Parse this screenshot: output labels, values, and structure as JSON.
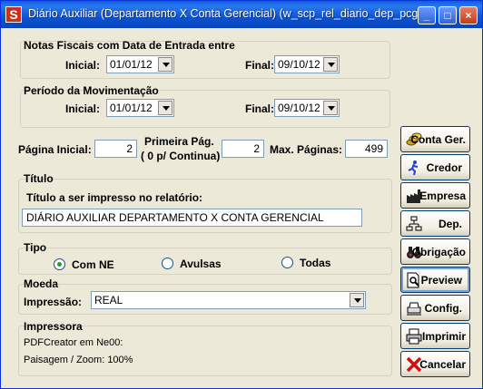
{
  "window": {
    "title": "Diário Auxiliar (Departamento X Conta Gerencial) (w_scp_rel_diario_dep_pcg)",
    "icon_letter": "S",
    "controls": [
      "_",
      "□",
      "×"
    ]
  },
  "notas": {
    "title": "Notas Fiscais com Data de Entrada entre",
    "inicial_label": "Inicial:",
    "inicial_value": "01/01/12",
    "final_label": "Final:",
    "final_value": "09/10/12"
  },
  "periodo": {
    "title": "Período da Movimentação",
    "inicial_label": "Inicial:",
    "inicial_value": "01/01/12",
    "final_label": "Final:",
    "final_value": "09/10/12"
  },
  "paginas": {
    "inicial_label": "Página Inicial:",
    "inicial_value": "2",
    "primeira_label_1": "Primeira Pág.",
    "primeira_label_2": "( 0 p/ Continua)",
    "primeira_value": "2",
    "max_label": "Max. Páginas:",
    "max_value": "499"
  },
  "titulo": {
    "group_label": "Título",
    "field_label": "Título a ser impresso no relatório:",
    "value": "DIÁRIO AUXILIAR DEPARTAMENTO X CONTA GERENCIAL"
  },
  "tipo": {
    "group_label": "Tipo",
    "options": [
      "Com NE",
      "Avulsas",
      "Todas"
    ],
    "selected": "Com NE"
  },
  "moeda": {
    "group_label": "Moeda",
    "impressao_label": "Impressão:",
    "value": "REAL"
  },
  "impressora": {
    "group_label": "Impressora",
    "printer": "PDFCreator em Ne00:",
    "layout": "Paisagem / Zoom: 100%"
  },
  "buttons": {
    "conta_ger": "Conta Ger.",
    "credor": "Credor",
    "empresa": "Empresa",
    "dep": "Dep.",
    "obrigacao": "Obrigação",
    "preview": "Preview",
    "config": "Config.",
    "imprimir": "Imprimir",
    "cancelar": "Cancelar"
  },
  "icons": {
    "conta_ger": "coins-icon",
    "credor": "running-person-icon",
    "empresa": "factory-icon",
    "dep": "org-chart-icon",
    "obrigacao": "binoculars-icon",
    "preview": "document-magnifier-icon",
    "config": "printer-config-icon",
    "imprimir": "printer-icon",
    "cancelar": "red-x-icon"
  }
}
